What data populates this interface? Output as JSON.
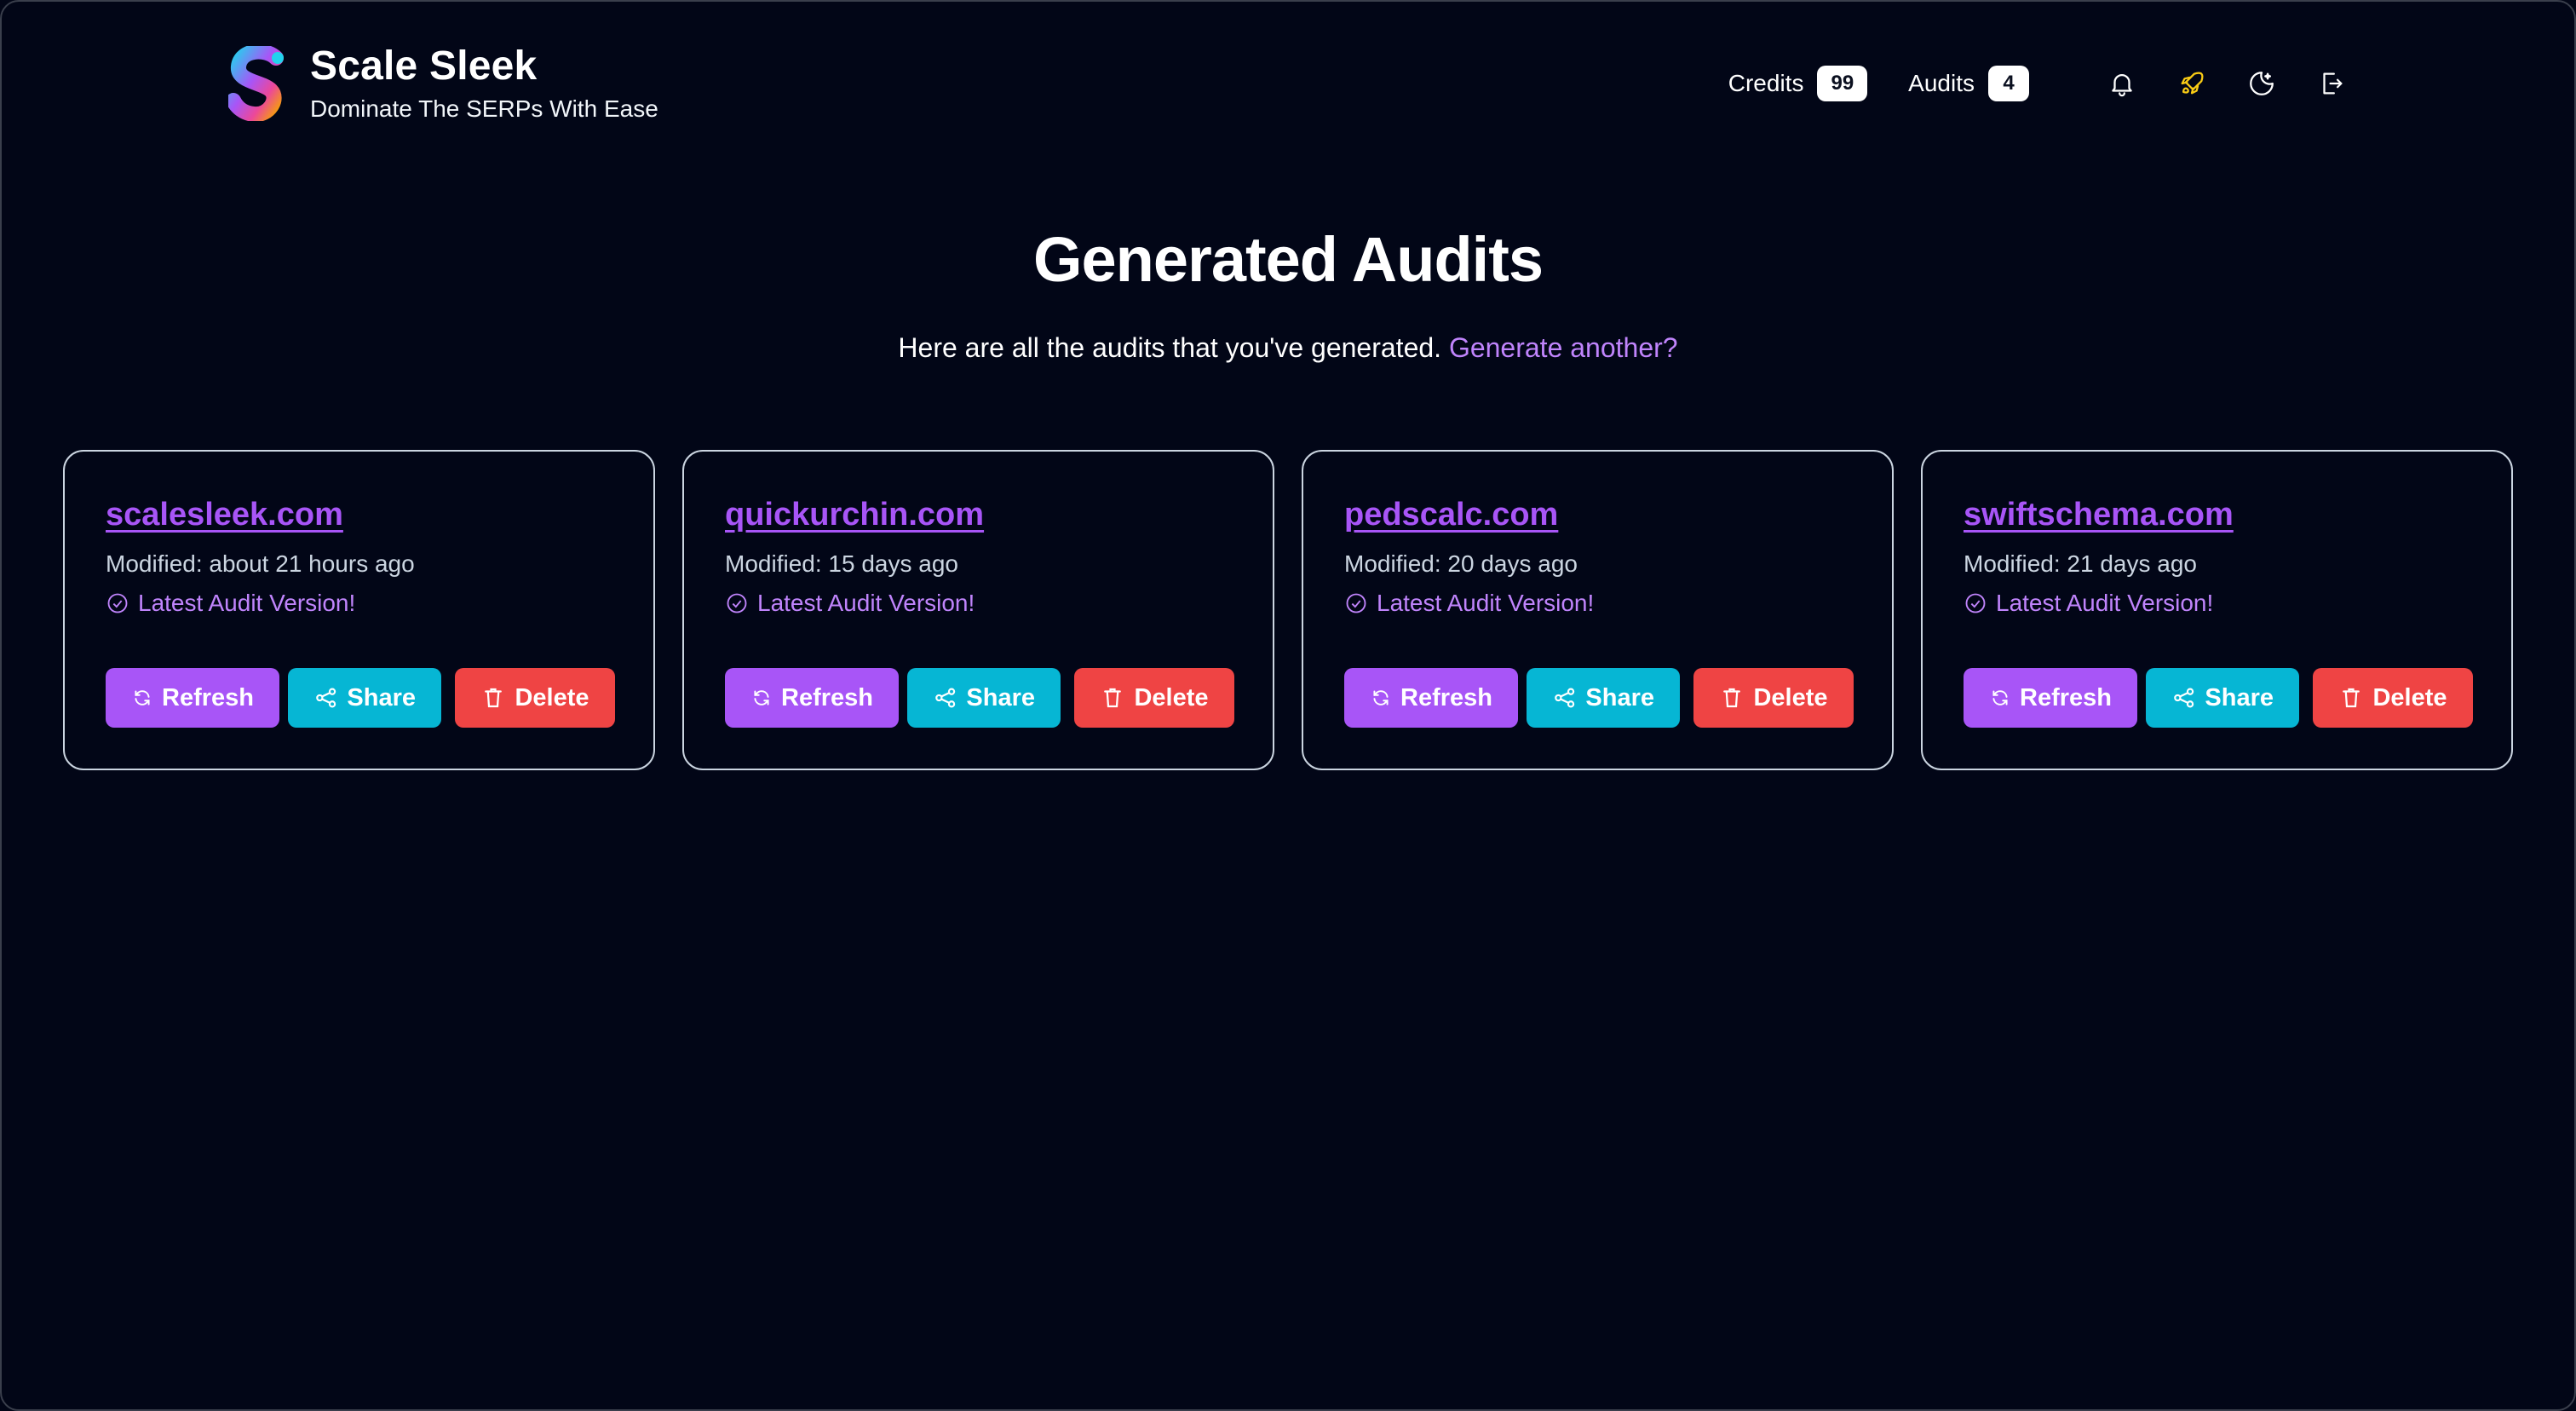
{
  "brand": {
    "title": "Scale Sleek",
    "subtitle": "Dominate The SERPs With Ease"
  },
  "nav": {
    "credits_label": "Credits",
    "credits_value": "99",
    "audits_label": "Audits",
    "audits_value": "4",
    "icons": [
      "bell-icon",
      "rocket-icon",
      "theme-toggle-icon",
      "logout-icon"
    ]
  },
  "page": {
    "title": "Generated Audits",
    "subtitle": "Here are all the audits that you've generated.",
    "generate_link": "Generate another?"
  },
  "cards": [
    {
      "domain": "scalesleek.com",
      "modified": "Modified: about 21 hours ago",
      "status": "Latest Audit Version!"
    },
    {
      "domain": "quickurchin.com",
      "modified": "Modified: 15 days ago",
      "status": "Latest Audit Version!"
    },
    {
      "domain": "pedscalc.com",
      "modified": "Modified: 20 days ago",
      "status": "Latest Audit Version!"
    },
    {
      "domain": "swiftschema.com",
      "modified": "Modified: 21 days ago",
      "status": "Latest Audit Version!"
    }
  ],
  "buttons": {
    "refresh": "Refresh",
    "share": "Share",
    "delete": "Delete"
  },
  "colors": {
    "background": "#020617",
    "accent_purple": "#a855f7",
    "accent_cyan": "#06b6d4",
    "danger_red": "#ef4444",
    "rocket_yellow": "#facc15"
  }
}
